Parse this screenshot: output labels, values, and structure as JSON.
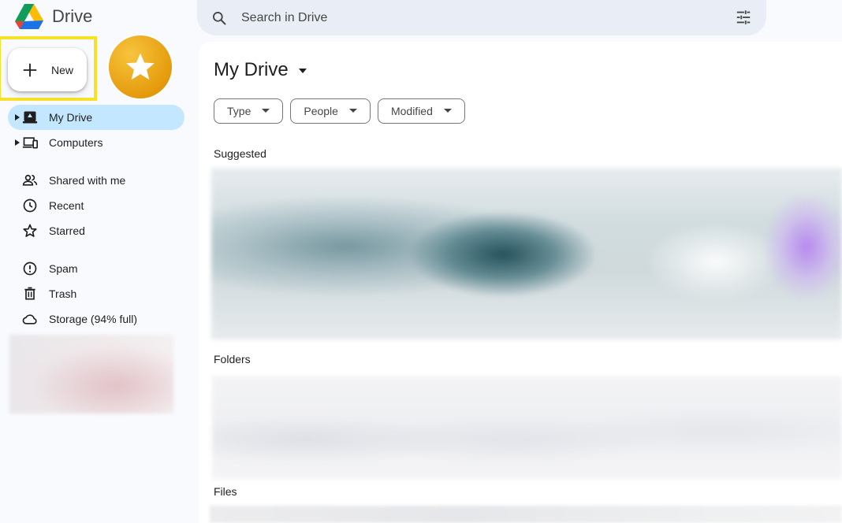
{
  "app": {
    "name": "Drive"
  },
  "search": {
    "placeholder": "Search in Drive"
  },
  "sidebar": {
    "new_label": "New",
    "items": [
      {
        "label": "My Drive",
        "active": true
      },
      {
        "label": "Computers"
      },
      {
        "label": "Shared with me"
      },
      {
        "label": "Recent"
      },
      {
        "label": "Starred"
      },
      {
        "label": "Spam"
      },
      {
        "label": "Trash"
      },
      {
        "label": "Storage (94% full)"
      }
    ]
  },
  "main": {
    "title": "My Drive",
    "filters": [
      "Type",
      "People",
      "Modified"
    ],
    "sections": [
      "Suggested",
      "Folders",
      "Files"
    ]
  },
  "colors": {
    "accent_active": "#c2e7ff",
    "highlight": "#f7e12a",
    "badge": "#e59b0c"
  }
}
